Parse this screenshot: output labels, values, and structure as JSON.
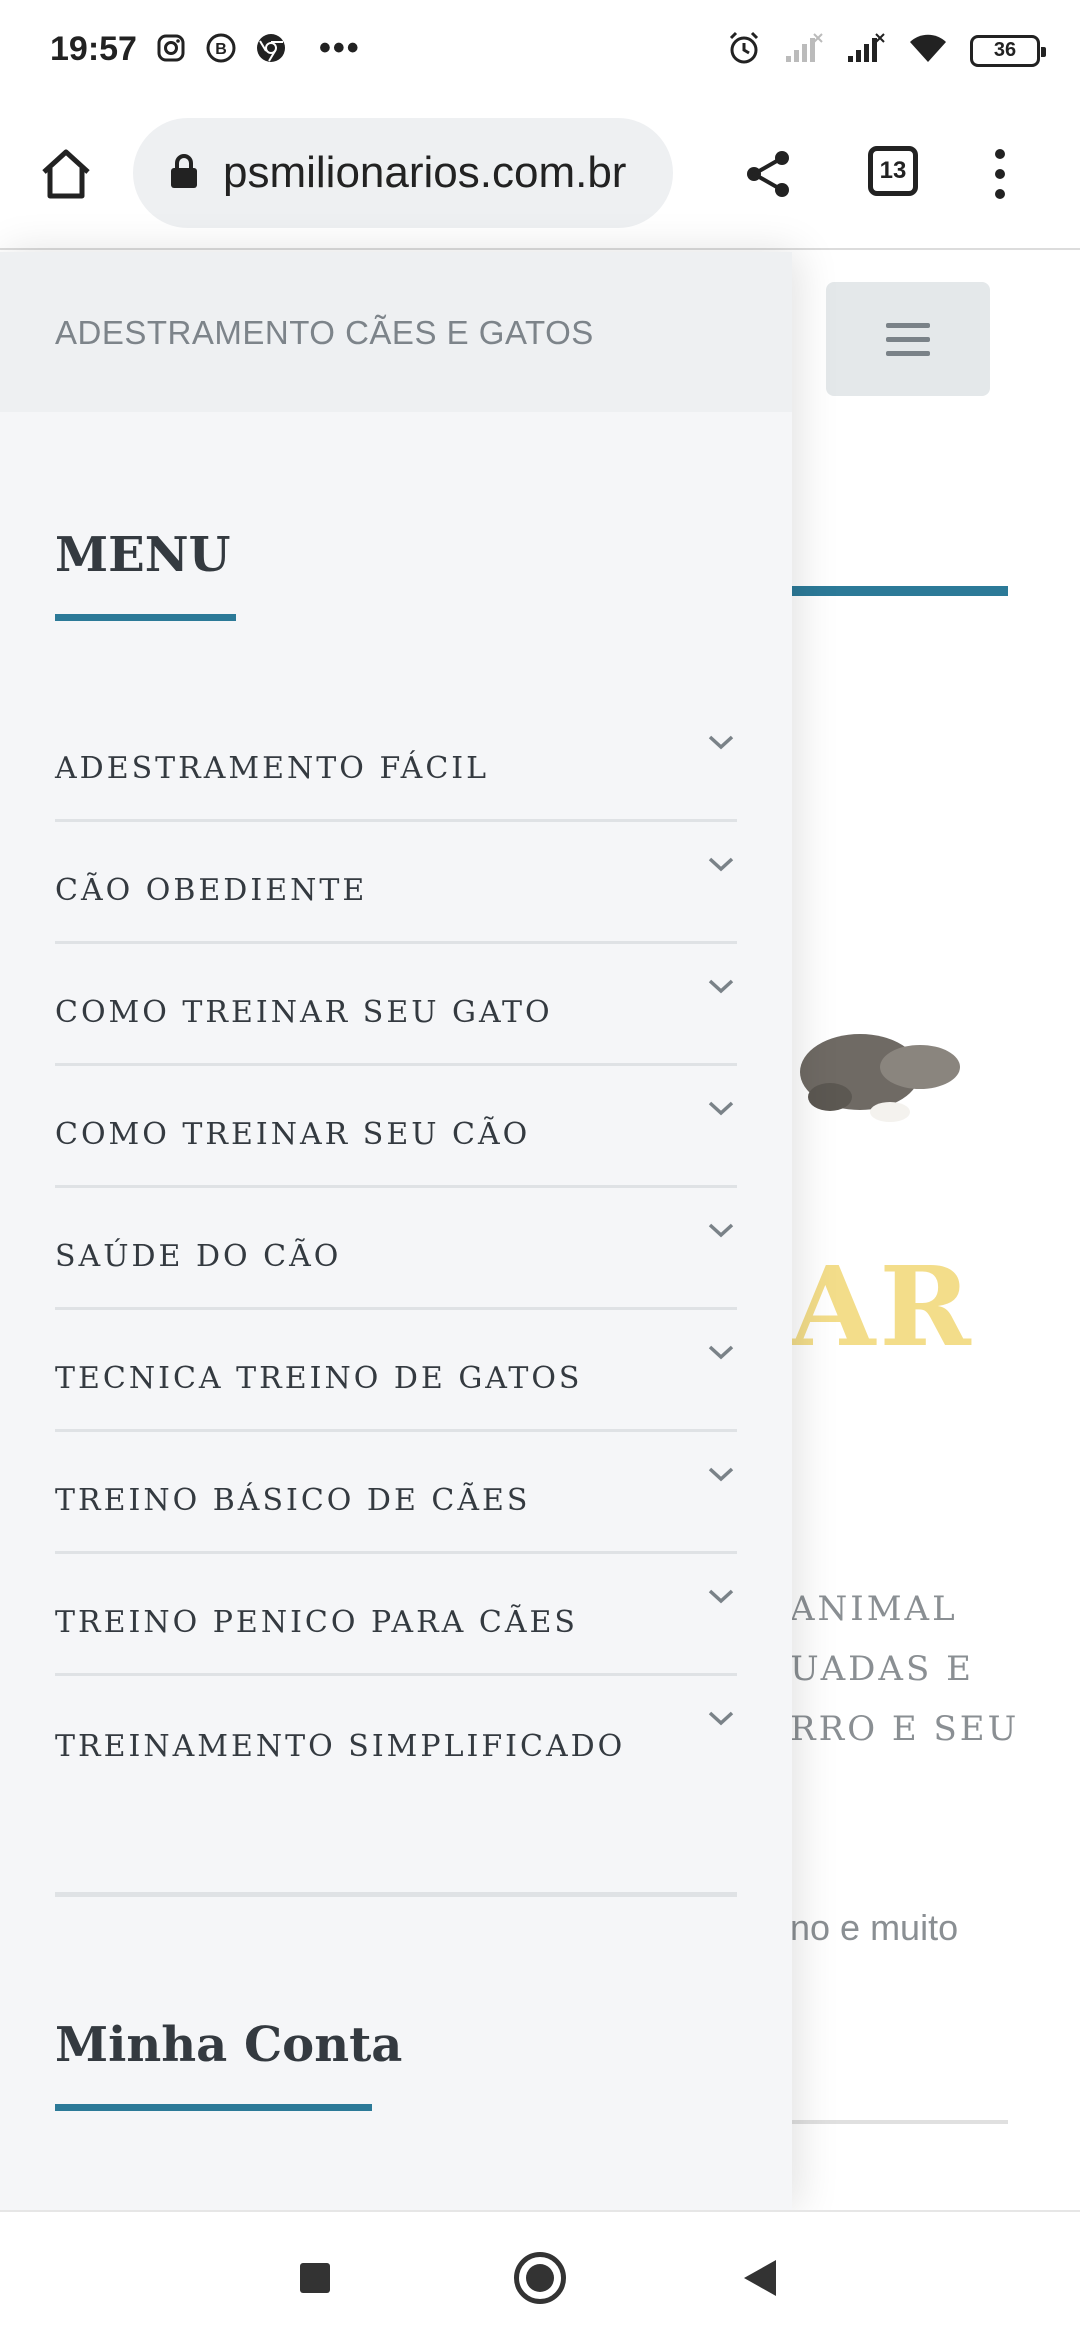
{
  "status_bar": {
    "time": "19:57",
    "dots": "•••",
    "battery": "36",
    "icons_left": [
      "instagram-icon",
      "business-chat-icon",
      "chrome-icon"
    ],
    "icons_right": [
      "alarm-icon",
      "signal-weak-icon",
      "signal-icon",
      "wifi-icon",
      "battery-icon"
    ]
  },
  "browser": {
    "url": "psmilionarios.com.br",
    "tab_count": "13"
  },
  "page": {
    "text_lines": [
      "ANIMAL",
      "UADAS E",
      "RRO E SEU"
    ],
    "small_text": "no e muito",
    "hero_letters": "AR"
  },
  "drawer": {
    "site_title": "ADESTRAMENTO CÃES E GATOS",
    "menu_title": "MENU",
    "menu_items": [
      {
        "label": "ADESTRAMENTO FÁCIL"
      },
      {
        "label": "CÃO OBEDIENTE"
      },
      {
        "label": "COMO TREINAR SEU GATO"
      },
      {
        "label": "COMO TREINAR SEU CÃO"
      },
      {
        "label": "SAÚDE DO CÃO"
      },
      {
        "label": "TECNICA TREINO DE GATOS"
      },
      {
        "label": "TREINO BÁSICO DE CÃES"
      },
      {
        "label": "TREINO PENICO PARA CÃES"
      },
      {
        "label": "TREINAMENTO SIMPLIFICADO"
      }
    ],
    "account_title": "Minha Conta"
  },
  "colors": {
    "accent": "#2c7a98",
    "drawer_bg": "#f5f6f8",
    "text_dark": "#343a40"
  }
}
